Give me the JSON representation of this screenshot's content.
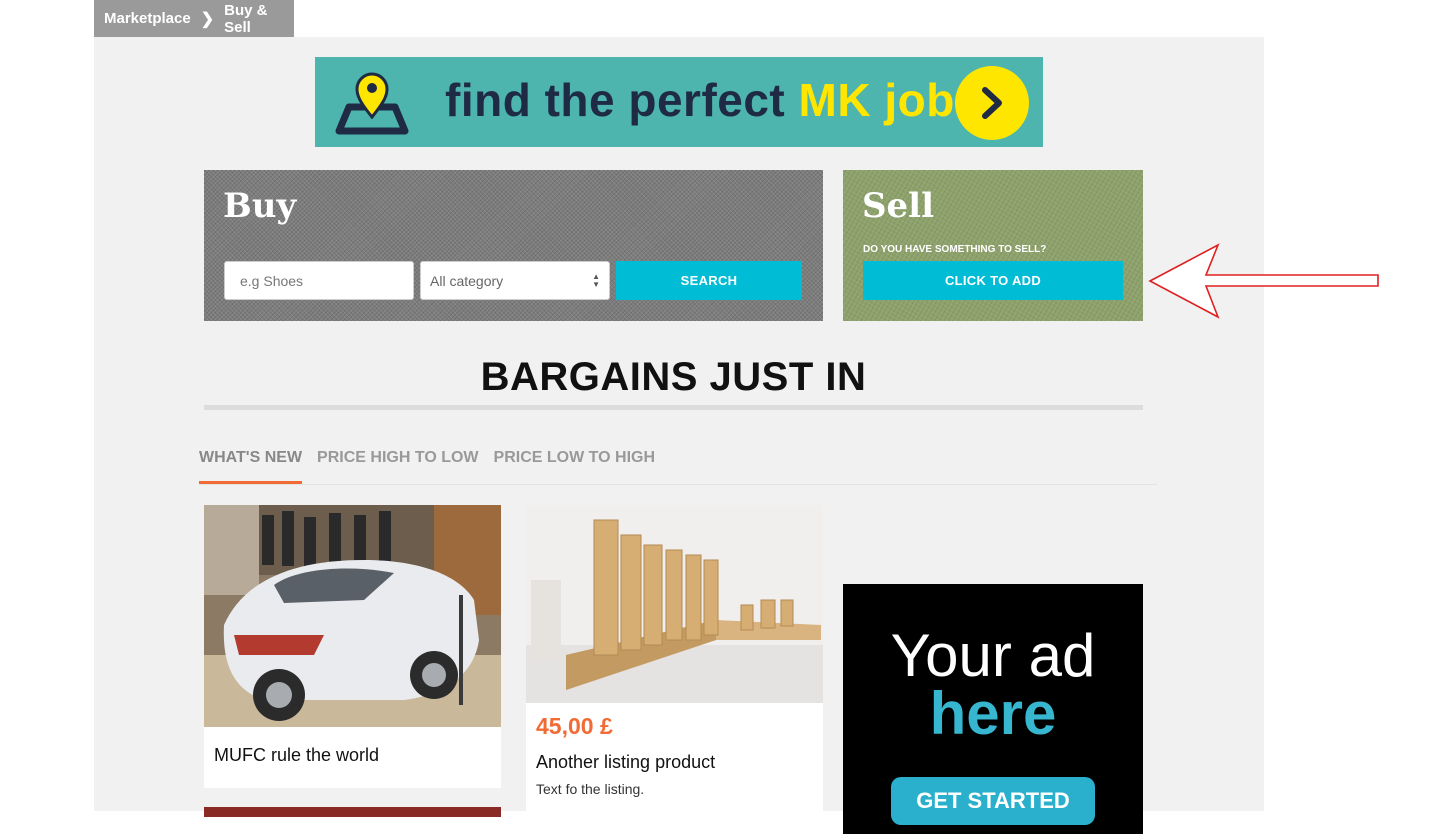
{
  "breadcrumb": {
    "items": [
      "Marketplace",
      "Buy & Sell"
    ]
  },
  "banner": {
    "text_main": "find the perfect ",
    "text_highlight": "MK job",
    "icons": [
      "map-pin-icon",
      "chevron-right-icon"
    ]
  },
  "buy": {
    "title": "Buy",
    "search_placeholder": "e.g Shoes",
    "category_selected": "All category",
    "search_label": "SEARCH"
  },
  "sell": {
    "title": "Sell",
    "question": "DO YOU HAVE SOMETHING TO SELL?",
    "add_label": "CLICK TO ADD"
  },
  "section_title": "BARGAINS JUST IN",
  "tabs": [
    {
      "label": "WHAT'S NEW",
      "active": true
    },
    {
      "label": "PRICE HIGH TO LOW",
      "active": false
    },
    {
      "label": "PRICE LOW TO HIGH",
      "active": false
    }
  ],
  "listings": [
    {
      "title": "MUFC rule the world"
    },
    {
      "price": "45,00 £",
      "title": "Another listing product",
      "description": "Text fo the listing."
    }
  ],
  "ad": {
    "line1": "Your ad",
    "line2": "here",
    "button_label": "GET STARTED"
  },
  "colors": {
    "accent": "#00bcd4",
    "price": "#f26b35",
    "banner_bg": "#4db5ae",
    "banner_highlight": "#ffe600"
  }
}
